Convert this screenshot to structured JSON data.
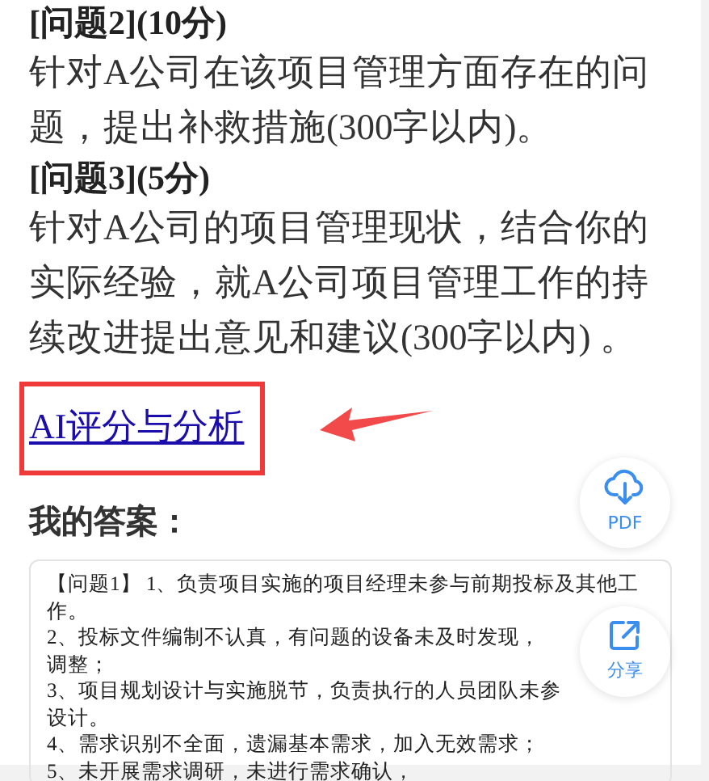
{
  "question_blocks": [
    {
      "heading": "[问题2](10分)",
      "text": "针对A公司在该项目管理方面存在的问题，提出补救措施(300字以内)。"
    },
    {
      "heading": "[问题3](5分)",
      "text": "针对A公司的项目管理现状，结合你的实际经验，就A公司项目管理工作的持续改进提出意见和建议(300字以内) 。"
    }
  ],
  "ai_link": {
    "label": "AI评分与分析",
    "highlighted": true
  },
  "answer_title": "我的答案：",
  "answer_lines": [
    "【问题1】 1、负责项目实施的项目经理未参与前期投标及其他工",
    "作。",
    "2、投标文件编制不认真，有问题的设备未及时发现，",
    "调整；",
    "3、项目规划设计与实施脱节，负责执行的人员团队未参",
    "设计。",
    "4、需求识别不全面，遗漏基本需求，加入无效需求；",
    "5、未开展需求调研，未进行需求确认，"
  ],
  "float_buttons": [
    {
      "kind": "pdf",
      "label": "PDF"
    },
    {
      "kind": "share",
      "label": "分享"
    }
  ]
}
